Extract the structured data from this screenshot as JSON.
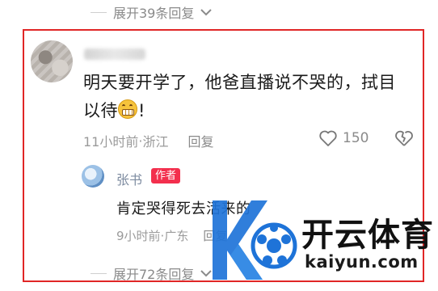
{
  "thread": {
    "expand_top": "展开39条回复",
    "expand_bottom": "展开72条回复"
  },
  "comment": {
    "text_main": "明天要开学了，他爸直播说不哭的，拭目以待",
    "text_tail": "!",
    "emoji": "grinning-face-emoji",
    "time": "11小时前",
    "separator": " · ",
    "location": "浙江",
    "reply_label": "回复",
    "like_count": "150"
  },
  "author_reply": {
    "name": "张书",
    "badge": "作者",
    "text": "肯定哭得死去活来的",
    "time": "9小时前",
    "separator": " · ",
    "location": "广东",
    "reply_label": "回复"
  },
  "watermark": {
    "brand": "开云体育",
    "domain": "kaiyun.com"
  },
  "colors": {
    "highlight_border": "#e02626",
    "author_badge": "#f32f4d",
    "watermark_blue": "#1e73d8"
  }
}
